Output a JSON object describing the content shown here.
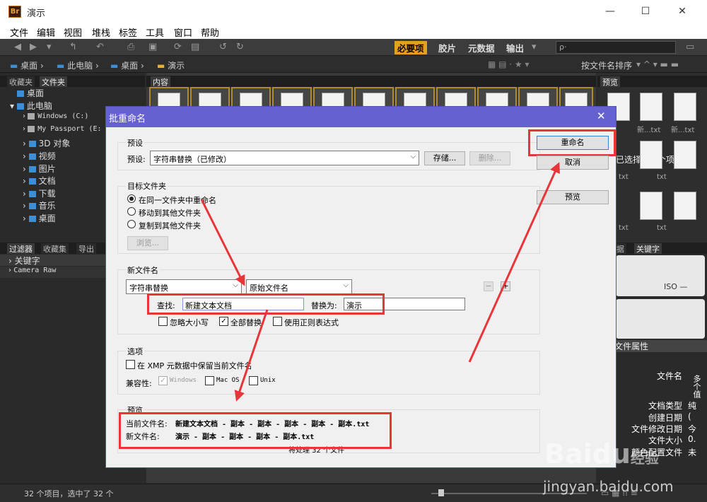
{
  "window": {
    "title": "演示",
    "app_icon": "Br",
    "minimize": "—",
    "maximize": "☐",
    "close": "✕"
  },
  "menu": [
    "文件",
    "编辑",
    "视图",
    "堆栈",
    "标签",
    "工具",
    "窗口",
    "帮助"
  ],
  "workspaces": {
    "active": "必要项",
    "items": [
      "胶片",
      "元数据",
      "输出"
    ],
    "search_placeholder": "ρ·"
  },
  "breadcrumb": [
    "桌面",
    "此电脑",
    "桌面",
    "演示"
  ],
  "sort_label": "按文件名排序",
  "left_panel": {
    "tabs": [
      "收藏夹",
      "文件夹"
    ],
    "tree": [
      "桌面",
      "此电脑",
      "Windows (C:)",
      "My Passport (E:",
      "3D 对象",
      "视频",
      "图片",
      "文档",
      "下载",
      "音乐",
      "桌面"
    ]
  },
  "filter_panel": {
    "tabs": [
      "过滤器",
      "收藏集",
      "导出"
    ],
    "items": [
      "关键字",
      "Camera Raw"
    ]
  },
  "content_tab": "内容",
  "preview_panel": {
    "tab": "预览",
    "thumb_labels": [
      "新...txt",
      "新...txt",
      "txt",
      "txt",
      "txt",
      "txt"
    ],
    "selected_banner": "已选择 32 个项目"
  },
  "meta_panel": {
    "tabs": [
      "据",
      "关键字"
    ],
    "section": "文件属性",
    "iso": "ISO —",
    "rows": [
      {
        "label": "文件名",
        "value": "多个值"
      },
      {
        "label": "文档类型",
        "value": "纯"
      },
      {
        "label": "创建日期",
        "value": "("
      },
      {
        "label": "文件修改日期",
        "value": "今"
      },
      {
        "label": "文件大小",
        "value": "0."
      },
      {
        "label": "颜色配置文件",
        "value": "未"
      }
    ]
  },
  "status": {
    "count_text": "32 个项目，选中了 32 个"
  },
  "dialog": {
    "title": "批重命名",
    "close": "✕",
    "preset": {
      "group": "预设",
      "label": "预设:",
      "value": "字符串替换（已修改）",
      "save": "存储...",
      "delete": "删除..."
    },
    "target": {
      "group": "目标文件夹",
      "options": [
        "在同一文件夹中重命名",
        "移动到其他文件夹",
        "复制到其他文件夹"
      ],
      "browse": "浏览..."
    },
    "newname": {
      "group": "新文件名",
      "method": "字符串替换",
      "source": "原始文件名",
      "find_label": "查找:",
      "find_value": "新建文本文档",
      "replace_label": "替换为:",
      "replace_value": "演示",
      "ignore_case": "忽略大小写",
      "replace_all": "全部替换",
      "use_regex": "使用正则表达式",
      "minus": "−",
      "plus": "+"
    },
    "options": {
      "group": "选项",
      "keep_xmp": "在 XMP 元数据中保留当前文件名",
      "compat_label": "兼容性:",
      "windows": "Windows",
      "macos": "Mac OS",
      "unix": "Unix"
    },
    "preview": {
      "group": "预览",
      "current_label": "当前文件名:",
      "current_value": "新建文本文档 - 副本 - 副本 - 副本 - 副本 - 副本.txt",
      "new_label": "新文件名:",
      "new_value": "演示 - 副本 - 副本 - 副本 - 副本.txt",
      "summary": "将处理 32 个文件"
    },
    "buttons": {
      "rename": "重命名",
      "cancel": "取消",
      "preview": "预览"
    }
  },
  "watermark": {
    "brand": "Baidu",
    "sub": "经验",
    "url": "jingyan.baidu.com"
  },
  "colors": {
    "dialog_title": "#6661d0",
    "highlight": "#e8353a",
    "workspace_active": "#e6a020"
  }
}
